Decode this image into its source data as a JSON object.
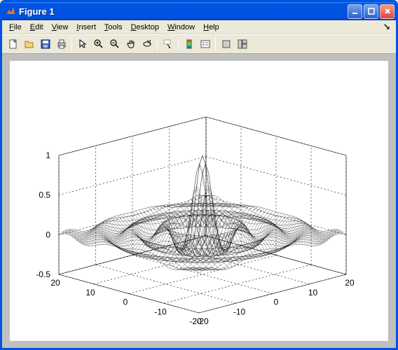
{
  "window": {
    "title": "Figure 1"
  },
  "menubar": {
    "items": [
      {
        "label": "File",
        "accel_index": 0
      },
      {
        "label": "Edit",
        "accel_index": 0
      },
      {
        "label": "View",
        "accel_index": 0
      },
      {
        "label": "Insert",
        "accel_index": 0
      },
      {
        "label": "Tools",
        "accel_index": 0
      },
      {
        "label": "Desktop",
        "accel_index": 0
      },
      {
        "label": "Window",
        "accel_index": 0
      },
      {
        "label": "Help",
        "accel_index": 0
      }
    ]
  },
  "toolbar": {
    "items": [
      {
        "name": "new-figure",
        "icon": "new-icon"
      },
      {
        "name": "open-file",
        "icon": "open-icon"
      },
      {
        "name": "save-figure",
        "icon": "save-icon"
      },
      {
        "name": "print-figure",
        "icon": "print-icon"
      },
      {
        "name": "edit-plot",
        "icon": "pointer-icon"
      },
      {
        "name": "zoom-in",
        "icon": "zoom-in-icon"
      },
      {
        "name": "zoom-out",
        "icon": "zoom-out-icon"
      },
      {
        "name": "pan",
        "icon": "pan-icon"
      },
      {
        "name": "rotate-3d",
        "icon": "rotate3d-icon"
      },
      {
        "name": "data-cursor",
        "icon": "datacursor-icon"
      },
      {
        "name": "insert-colorbar",
        "icon": "colorbar-icon"
      },
      {
        "name": "insert-legend",
        "icon": "legend-icon"
      },
      {
        "name": "hide-plot-tools",
        "icon": "hide-tools-icon"
      },
      {
        "name": "show-plot-tools",
        "icon": "show-tools-icon"
      }
    ]
  },
  "chart_data": {
    "type": "surface-mesh",
    "description": "sinc-like radial mesh peak at center",
    "x_range": [
      -20,
      20
    ],
    "y_range": [
      -20,
      20
    ],
    "z_range": [
      -0.5,
      1
    ],
    "x_ticks": [
      -20,
      -10,
      0,
      10,
      20
    ],
    "y_ticks": [
      -20,
      -10,
      0,
      10,
      20
    ],
    "z_ticks": [
      -0.5,
      0,
      0.5,
      1
    ],
    "title": "",
    "xlabel": "",
    "ylabel": "",
    "zlabel": ""
  }
}
